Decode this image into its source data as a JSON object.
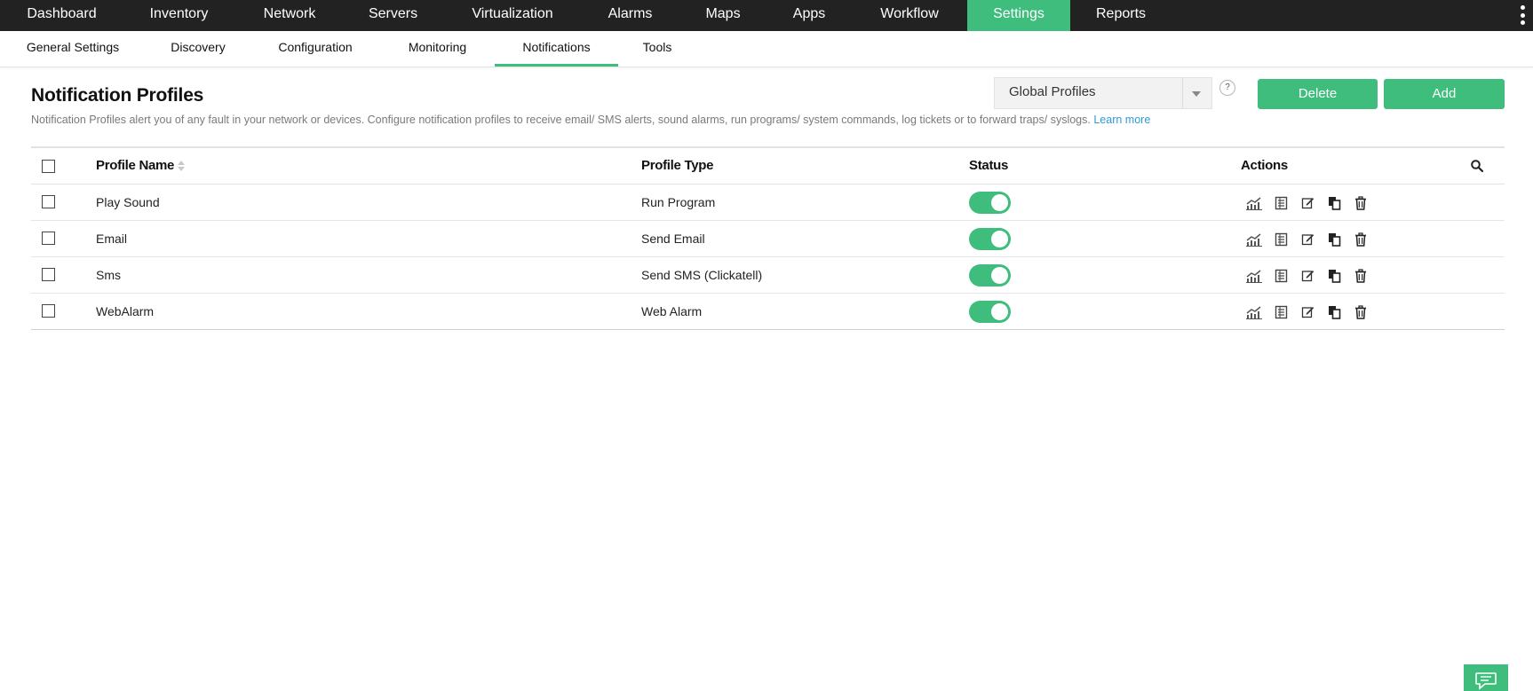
{
  "top_nav": {
    "tabs": [
      {
        "label": "Dashboard",
        "active": false
      },
      {
        "label": "Inventory",
        "active": false
      },
      {
        "label": "Network",
        "active": false
      },
      {
        "label": "Servers",
        "active": false
      },
      {
        "label": "Virtualization",
        "active": false
      },
      {
        "label": "Alarms",
        "active": false
      },
      {
        "label": "Maps",
        "active": false
      },
      {
        "label": "Apps",
        "active": false
      },
      {
        "label": "Workflow",
        "active": false
      },
      {
        "label": "Settings",
        "active": true
      },
      {
        "label": "Reports",
        "active": false
      }
    ],
    "menu_icon": "more-vertical-icon"
  },
  "sub_nav": {
    "tabs": [
      {
        "label": "General Settings",
        "active": false
      },
      {
        "label": "Discovery",
        "active": false
      },
      {
        "label": "Configuration",
        "active": false
      },
      {
        "label": "Monitoring",
        "active": false
      },
      {
        "label": "Notifications",
        "active": true
      },
      {
        "label": "Tools",
        "active": false
      }
    ]
  },
  "page": {
    "title": "Notification Profiles",
    "description": "Notification Profiles alert you of any fault in your network or devices. Configure notification profiles to receive email/ SMS alerts, sound alarms, run programs/ system commands, log tickets or to forward traps/ syslogs.",
    "learn_more": "Learn more"
  },
  "controls": {
    "profile_select": "Global Profiles",
    "help": "?",
    "delete_label": "Delete",
    "add_label": "Add"
  },
  "table": {
    "headers": {
      "name": "Profile Name",
      "type": "Profile Type",
      "status": "Status",
      "actions": "Actions"
    },
    "rows": [
      {
        "name": "Play Sound",
        "type": "Run Program",
        "enabled": true
      },
      {
        "name": "Email",
        "type": "Send Email",
        "enabled": true
      },
      {
        "name": "Sms",
        "type": "Send SMS (Clickatell)",
        "enabled": true
      },
      {
        "name": "WebAlarm",
        "type": "Web Alarm",
        "enabled": true
      }
    ],
    "row_action_icons": [
      "chart-icon",
      "log-icon",
      "edit-icon",
      "copy-icon",
      "trash-icon"
    ]
  },
  "colors": {
    "accent": "#3fbd7d",
    "nav_bg": "#222222",
    "link": "#2f9bd6"
  }
}
